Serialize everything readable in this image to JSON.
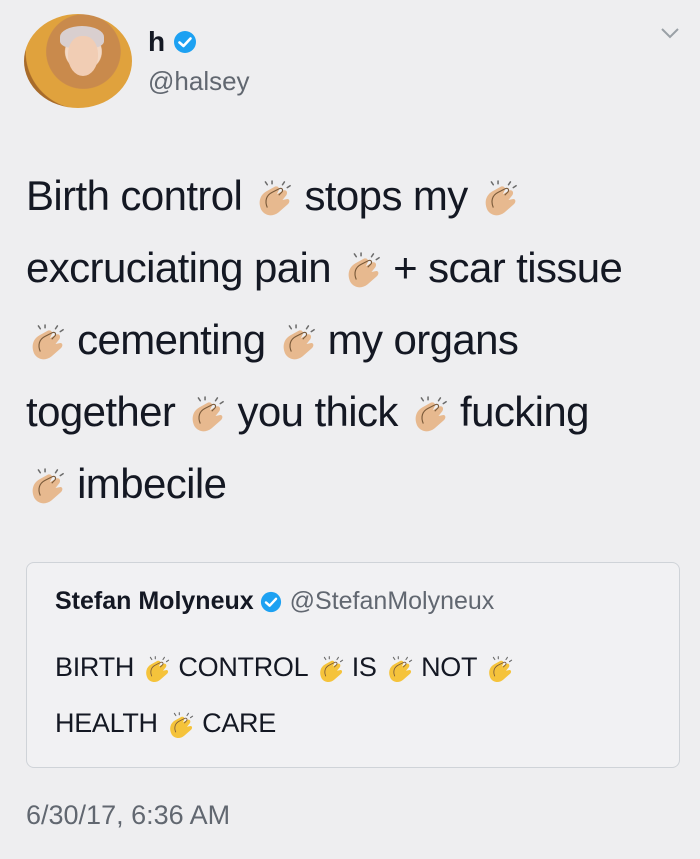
{
  "author": {
    "display_name": "h",
    "handle": "@halsey",
    "verified": true
  },
  "tweet_segments": [
    "Birth control",
    "stops my",
    "excruciating pain",
    "+ scar tissue",
    "cementing",
    "my organs",
    "together",
    "you thick",
    "fucking",
    "imbecile"
  ],
  "quoted_tweet": {
    "display_name": "Stefan Molyneux",
    "handle": "@StefanMolyneux",
    "verified": true,
    "segments": [
      "BIRTH",
      "CONTROL",
      "IS",
      "NOT",
      "HEALTH",
      "CARE"
    ]
  },
  "timestamp": "6/30/17, 6:36 AM",
  "colors": {
    "verified_blue": "#1da1f2",
    "clap_light": "#e7b98f",
    "clap_yellow": "#f5c33b",
    "secondary_text": "#616770"
  },
  "icons": [
    "verified-badge-icon",
    "chevron-down-icon",
    "clapping-hands-icon"
  ]
}
